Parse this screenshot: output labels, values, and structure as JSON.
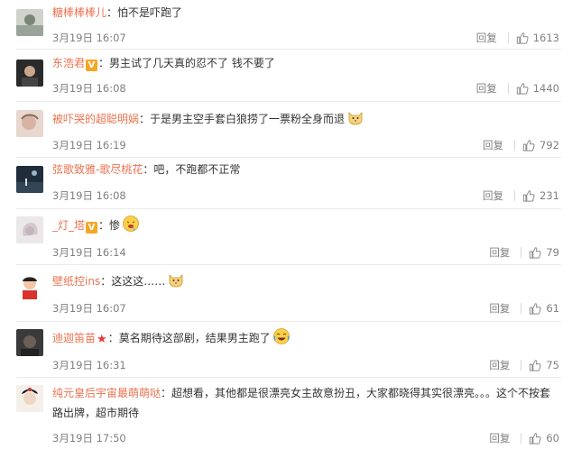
{
  "comments": [
    {
      "user": "糖棒棒棒儿",
      "text": "怕不是吓跑了",
      "time": "3月19日 16:07",
      "reply": "回复",
      "likes": "1613"
    },
    {
      "user": "东浩君",
      "text": "男主试了几天真的忍不了 钱不要了",
      "time": "3月19日 16:08",
      "reply": "回复",
      "likes": "1440"
    },
    {
      "user": "被吓哭的超聪明娲",
      "text": "于是男主空手套白狼捞了一票粉全身而退",
      "time": "3月19日 16:19",
      "reply": "回复",
      "likes": "792"
    },
    {
      "user": "弦歌致雅-歌尽桃花",
      "text": "吧，不跑都不正常",
      "time": "3月19日 16:08",
      "reply": "回复",
      "likes": "231"
    },
    {
      "user": "_灯_塔",
      "text": "惨",
      "time": "3月19日 16:14",
      "reply": "回复",
      "likes": "79"
    },
    {
      "user": "壁纸控ins",
      "text": "这这这……",
      "time": "3月19日 16:07",
      "reply": "回复",
      "likes": "61"
    },
    {
      "user": "迪迦笛苗",
      "text": "莫名期待这部剧，结果男主跑了",
      "time": "3月19日 16:31",
      "reply": "回复",
      "likes": "75"
    },
    {
      "user": "纯元皇后宇宙最萌萌哒",
      "text": "超想看，其他都是很漂亮女主故意扮丑，大家都晓得其实很漂亮。。。这个不按套路出牌，超市期待",
      "time": "3月19日 17:50",
      "reply": "回复",
      "likes": "60"
    }
  ],
  "badges": {
    "v": "V",
    "star": "★"
  },
  "colors": {
    "username": "#eb7350",
    "meta": "#808080",
    "text": "#333333"
  }
}
